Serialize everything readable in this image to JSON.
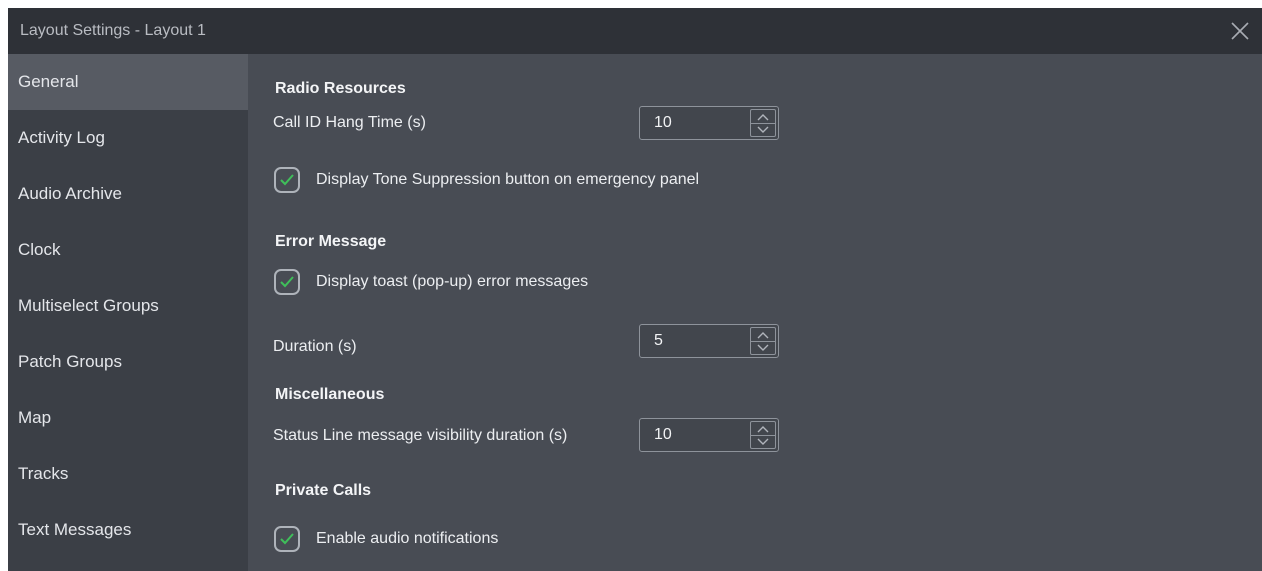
{
  "window": {
    "title": "Layout Settings - Layout 1",
    "close_icon": "close-icon"
  },
  "sidebar": {
    "items": [
      {
        "label": "General",
        "active": true
      },
      {
        "label": "Activity Log",
        "active": false
      },
      {
        "label": "Audio Archive",
        "active": false
      },
      {
        "label": "Clock",
        "active": false
      },
      {
        "label": "Multiselect Groups",
        "active": false
      },
      {
        "label": "Patch Groups",
        "active": false
      },
      {
        "label": "Map",
        "active": false
      },
      {
        "label": "Tracks",
        "active": false
      },
      {
        "label": "Text Messages",
        "active": false
      }
    ]
  },
  "radio_resources": {
    "title": "Radio Resources",
    "call_id_hang_time": {
      "label": "Call ID Hang Time (s)",
      "value": "10"
    },
    "tone_suppression": {
      "label": "Display Tone Suppression button on emergency panel",
      "checked": true
    }
  },
  "error_message": {
    "title": "Error Message",
    "toast": {
      "label": "Display toast (pop-up) error messages",
      "checked": true
    },
    "duration": {
      "label": "Duration (s)",
      "value": "5"
    }
  },
  "miscellaneous": {
    "title": "Miscellaneous",
    "status_line": {
      "label": "Status Line message visibility duration (s)",
      "value": "10"
    }
  },
  "private_calls": {
    "title": "Private Calls",
    "audio_notifications": {
      "label": "Enable audio notifications",
      "checked": true
    }
  },
  "colors": {
    "check_green": "#3fbf5a",
    "panel_bg": "#484c54",
    "sidebar_bg": "#3b3f46",
    "titlebar_bg": "#2e3137"
  }
}
